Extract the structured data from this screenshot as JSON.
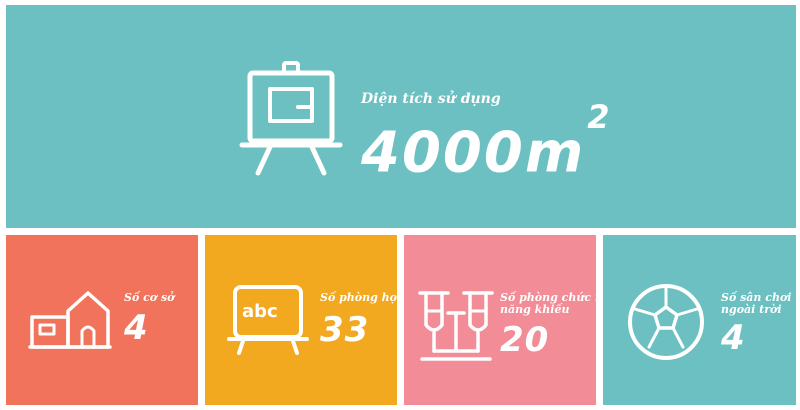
{
  "colors": {
    "teal": "#6cc0c2",
    "coral": "#f2735b",
    "amber": "#f2a81f",
    "pink": "#f28d97",
    "white": "#ffffff"
  },
  "hero": {
    "label": "Diện tích sử dụng",
    "value": "4000m",
    "unit_power": "2",
    "icon": "easel-board-icon"
  },
  "stats": [
    {
      "label": "Số cơ sở",
      "value": "4",
      "icon": "school-building-icon"
    },
    {
      "label": "Số phòng học",
      "value": "33",
      "icon": "abc-chalkboard-icon",
      "board_text": "abc"
    },
    {
      "label_line1": "Số phòng chức năng,",
      "label_line2": "năng khiếu",
      "value": "20",
      "icon": "test-tubes-icon"
    },
    {
      "label_line1": "Số sân chơi",
      "label_line2": "ngoài trời",
      "value": "4",
      "icon": "soccer-ball-icon"
    }
  ]
}
